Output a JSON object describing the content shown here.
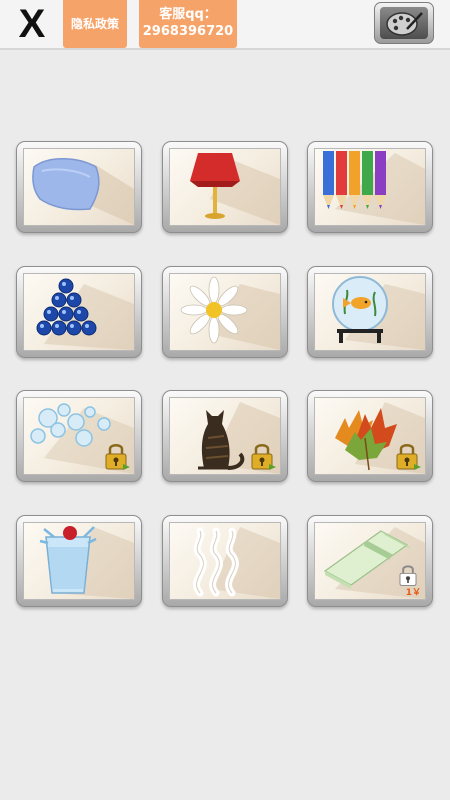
{
  "header": {
    "close_label": "X",
    "privacy_label": "隐私政策",
    "qq_label": "客服qq：",
    "qq_number": "2968396720",
    "palette_icon": "palette-icon"
  },
  "tiles": [
    {
      "subject": "pillow",
      "locked": false
    },
    {
      "subject": "lamp",
      "locked": false
    },
    {
      "subject": "colored-pencils",
      "locked": false
    },
    {
      "subject": "marbles",
      "locked": false
    },
    {
      "subject": "daisy",
      "locked": false
    },
    {
      "subject": "fishbowl",
      "locked": false
    },
    {
      "subject": "bubbles",
      "locked": true
    },
    {
      "subject": "cat",
      "locked": true
    },
    {
      "subject": "autumn-leaves",
      "locked": true
    },
    {
      "subject": "drink-cup",
      "locked": false
    },
    {
      "subject": "steam",
      "locked": false
    },
    {
      "subject": "eraser",
      "locked": true,
      "price": "1￥"
    }
  ],
  "colors": {
    "accent": "#f6a36a",
    "background": "#ebebeb",
    "lock": "#d9a521"
  }
}
